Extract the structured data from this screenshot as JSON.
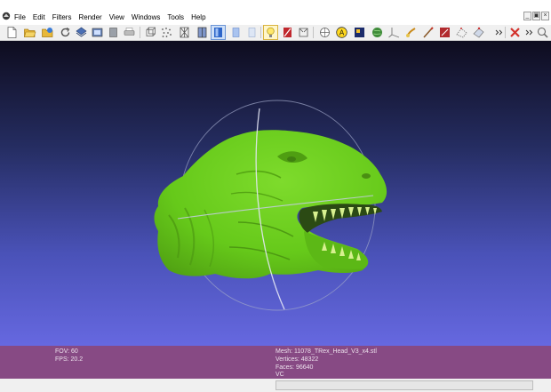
{
  "menus": [
    "File",
    "Edit",
    "Filters",
    "Render",
    "View",
    "Windows",
    "Tools",
    "Help"
  ],
  "window_controls": [
    "_",
    "̅□",
    "×"
  ],
  "toolbar_icons": [
    "new-file-icon",
    "open-folder-icon",
    "import-mesh-icon",
    "reload-icon",
    "export-mesh-icon",
    "snapshot-icon",
    "layer-icon",
    "print-icon",
    "bounding-box-icon",
    "points-icon",
    "wireframe-icon",
    "flat-lines-icon",
    "flat-icon",
    "smooth-icon",
    "texture-icon",
    "light-icon",
    "color-icon",
    "trackball-icon",
    "target-icon",
    "annotation-icon",
    "raster-icon",
    "globe-icon",
    "axes-icon",
    "paint-icon",
    "brush-icon",
    "measure-icon",
    "select-faces-icon",
    "select-vertices-icon",
    "overflow-chevron-icon",
    "delete-icon",
    "overflow-chevron-icon",
    "zoom-icon"
  ],
  "colors": {
    "mesh_green": "#66c91a",
    "viewport_top": "#0e0c1e",
    "viewport_bottom": "#6668e0",
    "infobar": "#874a84"
  },
  "info": {
    "fov": "FOV: 60",
    "fps": "FPS:   20.2",
    "mesh": "Mesh: 11078_TRex_Head_V3_x4.stl",
    "vertices": "Vertices: 48322",
    "faces": "Faces: 96640",
    "vc": "VC"
  },
  "status": {
    "progress": 0
  }
}
